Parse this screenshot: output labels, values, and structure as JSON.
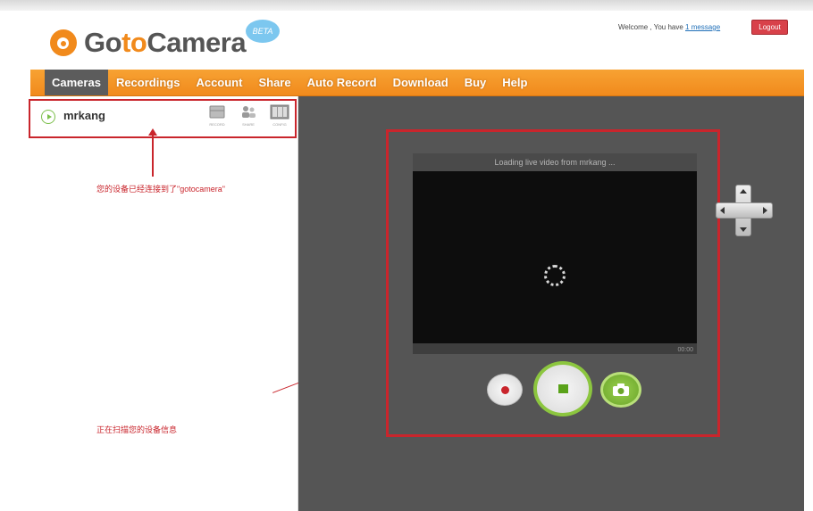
{
  "header": {
    "logo_pre": "Go",
    "logo_accent": "to",
    "logo_post": "Camera",
    "beta": "BETA",
    "welcome_text": "Welcome , You have ",
    "messages_link": "1 message",
    "logout_label": "Logout"
  },
  "nav": {
    "items": [
      {
        "label": "Cameras",
        "active": true
      },
      {
        "label": "Recordings"
      },
      {
        "label": "Account"
      },
      {
        "label": "Share"
      },
      {
        "label": "Auto Record"
      },
      {
        "label": "Download"
      },
      {
        "label": "Buy"
      },
      {
        "label": "Help"
      }
    ]
  },
  "camera_list": {
    "items": [
      {
        "name": "mrkang",
        "status": "online",
        "tools": [
          "RECORD",
          "SHARE",
          "CONFIG"
        ]
      }
    ]
  },
  "annotations": {
    "note_connected": "您的设备已经连接到了\"gotocamera\"",
    "note_scanning": "正在扫描您的设备信息"
  },
  "player": {
    "status": "Loading live video from mrkang ...",
    "time": "00:00"
  },
  "colors": {
    "brand_orange": "#f18a1c",
    "annotation_red": "#c9252c",
    "live_green": "#8cc63f",
    "logout_red": "#d8414a"
  }
}
